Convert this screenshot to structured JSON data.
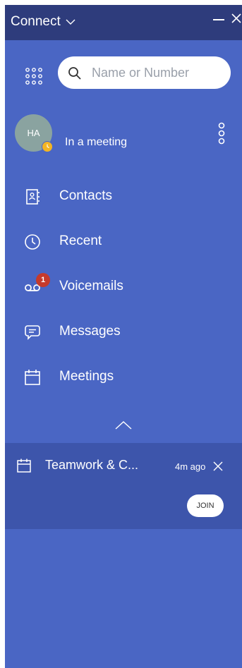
{
  "app": {
    "title": "Connect",
    "colors": {
      "titlebar": "#2e3c7c",
      "background": "#4a66c4",
      "meeting_card": "#3d55ab",
      "presence": "#f3b523",
      "badge": "#c53a2c",
      "avatar": "#8aa3a0"
    }
  },
  "search": {
    "placeholder": "Name or Number",
    "value": ""
  },
  "profile": {
    "initials": "HA",
    "name": "",
    "status": "In a meeting",
    "presence_icon": "clock-presence-icon"
  },
  "nav": {
    "items": [
      {
        "label": "Contacts",
        "icon": "contacts-book-icon"
      },
      {
        "label": "Recent",
        "icon": "clock-icon"
      },
      {
        "label": "Voicemails",
        "icon": "voicemail-icon",
        "badge": "1"
      },
      {
        "label": "Messages",
        "icon": "message-bubble-icon"
      },
      {
        "label": "Meetings",
        "icon": "calendar-icon"
      }
    ]
  },
  "meeting": {
    "title": "Teamwork & C...",
    "time": "4m ago",
    "join_label": "JOIN",
    "icon": "calendar-icon"
  }
}
